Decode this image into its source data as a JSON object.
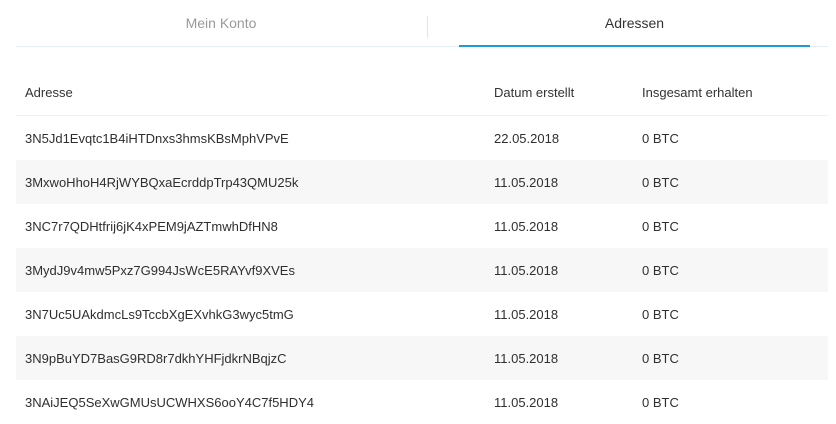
{
  "tabs": [
    {
      "label": "Mein Konto",
      "active": false
    },
    {
      "label": "Adressen",
      "active": true
    }
  ],
  "colors": {
    "accent": "#1e9ad6",
    "row_shade": "#f7f7f7",
    "inactive_tab_text": "#9a9a9a"
  },
  "table": {
    "headers": [
      "Adresse",
      "Datum erstellt",
      "Insgesamt erhalten"
    ],
    "rows": [
      {
        "address": "3N5Jd1Evqtc1B4iHTDnxs3hmsKBsMphVPvE",
        "date": "22.05.2018",
        "total": "0 BTC"
      },
      {
        "address": "3MxwoHhoH4RjWYBQxaEcrddpTrp43QMU25k",
        "date": "11.05.2018",
        "total": "0 BTC"
      },
      {
        "address": "3NC7r7QDHtfrij6jK4xPEM9jAZTmwhDfHN8",
        "date": "11.05.2018",
        "total": "0 BTC"
      },
      {
        "address": "3MydJ9v4mw5Pxz7G994JsWcE5RAYvf9XVEs",
        "date": "11.05.2018",
        "total": "0 BTC"
      },
      {
        "address": "3N7Uc5UAkdmcLs9TccbXgEXvhkG3wyc5tmG",
        "date": "11.05.2018",
        "total": "0 BTC"
      },
      {
        "address": "3N9pBuYD7BasG9RD8r7dkhYHFjdkrNBqjzC",
        "date": "11.05.2018",
        "total": "0 BTC"
      },
      {
        "address": "3NAiJEQ5SeXwGMUsUCWHXS6ooY4C7f5HDY4",
        "date": "11.05.2018",
        "total": "0 BTC"
      }
    ]
  }
}
